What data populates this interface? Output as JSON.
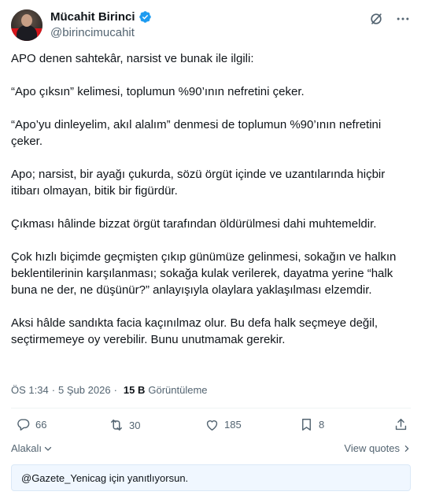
{
  "author": {
    "name": "Mücahit Birinci",
    "handle": "@birincimucahit"
  },
  "header_icons": [
    "grok-icon",
    "more-icon"
  ],
  "post": {
    "paragraphs": [
      "APO denen sahtekâr, narsist ve bunak ile ilgili:",
      "“Apo çıksın” kelimesi, toplumun %90’ının nefretini çeker.",
      "“Apo’yu dinleyelim, akıl alalım” denmesi de toplumun %90’ının nefretini çeker.",
      "Apo; narsist, bir ayağı çukurda, sözü örgüt içinde ve uzantılarında hiçbir itibarı olmayan, bitik bir figürdür.",
      "Çıkması hâlinde bizzat örgüt tarafından öldürülmesi dahi muhtemeldir.",
      "Çok hızlı biçimde geçmişten çıkıp günümüze gelinmesi, sokağın ve halkın beklentilerinin karşılanması; sokağa kulak verilerek, dayatma yerine “halk buna ne der, ne düşünür?” anlayışıyla olaylara yaklaşılması elzemdir.",
      "Aksi hâlde sandıkta facia kaçınılmaz olur. Bu defa halk seçmeye değil, seçtirmemeye oy verebilir. Bunu unutmamak gerekir."
    ]
  },
  "meta": {
    "time": "ÖS 1:34",
    "date": "5 Şub 2026",
    "separator": "·",
    "views_count": "15 B",
    "views_label": "Görüntüleme"
  },
  "actions": {
    "replies": "66",
    "reposts": "30",
    "likes": "185",
    "bookmarks": "8"
  },
  "related_label": "Alakalı",
  "view_quotes_label": "View quotes",
  "reply_context": "@Gazete_Yenicag için yanıtlıyorsun.",
  "colors": {
    "text": "#0f1419",
    "secondary": "#536471",
    "verified": "#1d9bf0",
    "divider": "#eff3f4",
    "reply_bg": "#f0f7ff"
  }
}
